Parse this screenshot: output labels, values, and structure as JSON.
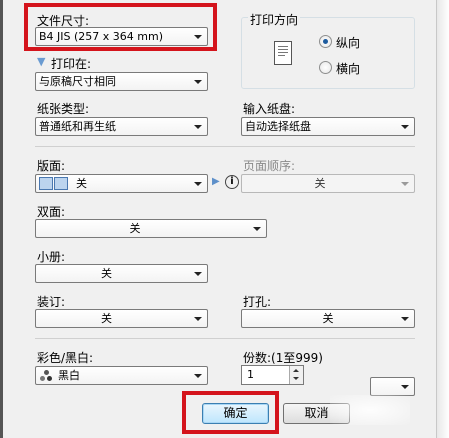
{
  "paper_size": {
    "label": "文件尺寸:",
    "value": "B4 JIS (257 x 364 mm)"
  },
  "print_on": {
    "label": "打印在:",
    "value": "与原稿尺寸相同"
  },
  "orientation": {
    "label": "打印方向",
    "portrait": "纵向",
    "landscape": "横向",
    "selected": "portrait"
  },
  "paper_type": {
    "label": "纸张类型:",
    "value": "普通纸和再生纸"
  },
  "input_tray": {
    "label": "输入纸盘:",
    "value": "自动选择纸盘"
  },
  "layout": {
    "label": "版面:",
    "value": "关"
  },
  "page_order": {
    "label": "页面顺序:",
    "value": "关"
  },
  "duplex": {
    "label": "双面:",
    "value": "关"
  },
  "booklet": {
    "label": "小册:",
    "value": "关"
  },
  "binding": {
    "label": "装订:",
    "value": "关"
  },
  "punch": {
    "label": "打孔:",
    "value": "关"
  },
  "color_mode": {
    "label": "彩色/黑白:",
    "value": "黑白"
  },
  "copies": {
    "label": "份数:(1至999)",
    "value": "1"
  },
  "buttons": {
    "ok": "确定",
    "cancel": "取消"
  },
  "colors": {
    "highlight_red": "#d4141c",
    "default_button": "#3c7fb1"
  }
}
